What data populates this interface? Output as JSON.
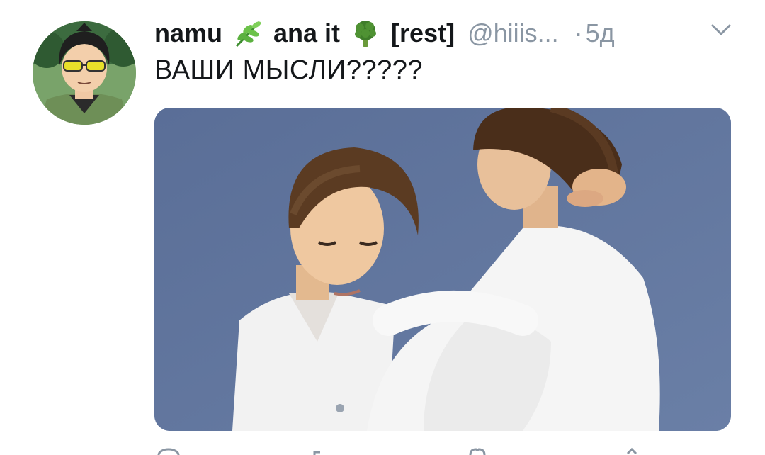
{
  "tweet": {
    "name_part1": "namu",
    "name_part2": "ana it",
    "name_part3": "[rest]",
    "handle": "@hiiis...",
    "separator": "·",
    "time": "5д",
    "text": "ВАШИ МЫСЛИ?????",
    "icons": {
      "emoji1": "herb-emoji-icon",
      "emoji2": "broccoli-emoji-icon",
      "menu": "chevron-down-icon"
    }
  },
  "colors": {
    "secondary_text": "#8a96a3",
    "primary_text": "#14171a",
    "media_background": "#5c7199"
  }
}
